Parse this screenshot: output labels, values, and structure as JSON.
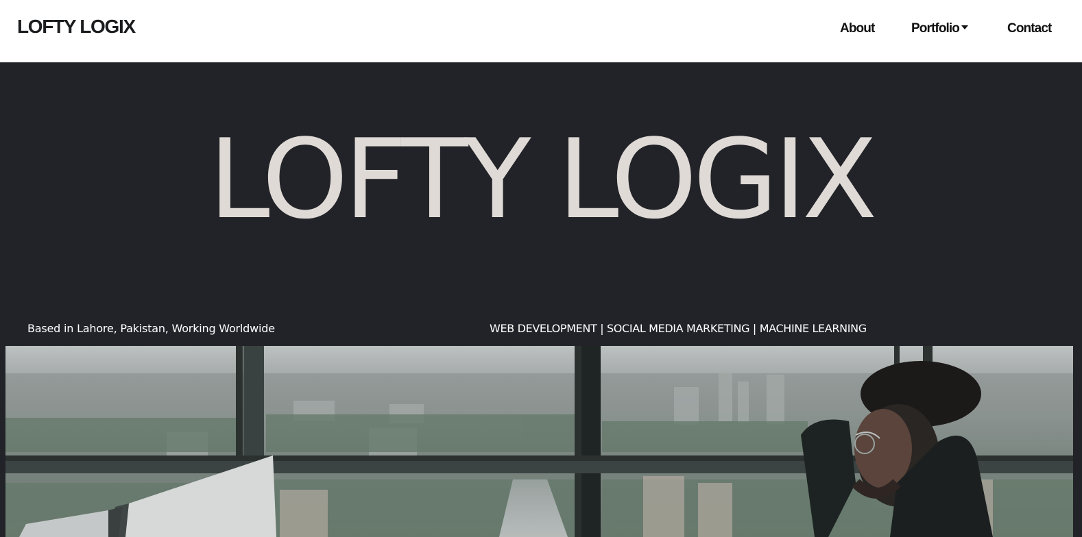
{
  "navbar": {
    "brand": "LOFTY LOGIX",
    "links": [
      {
        "label": "About"
      },
      {
        "label": "Portfolio",
        "has_dropdown": true
      },
      {
        "label": "Contact"
      }
    ]
  },
  "hero": {
    "title": "LOFTY LOGIX",
    "location": "Based in Lahore, Pakistan, Working Worldwide",
    "services": "WEB DEVELOPMENT | SOCIAL MEDIA MARKETING | MACHINE LEARNING"
  },
  "colors": {
    "navbar_bg": "#ffffff",
    "hero_bg": "#212328",
    "hero_title": "#e0dad6",
    "text_dark": "#111111"
  },
  "icons": {
    "dropdown": "caret-down-icon"
  }
}
